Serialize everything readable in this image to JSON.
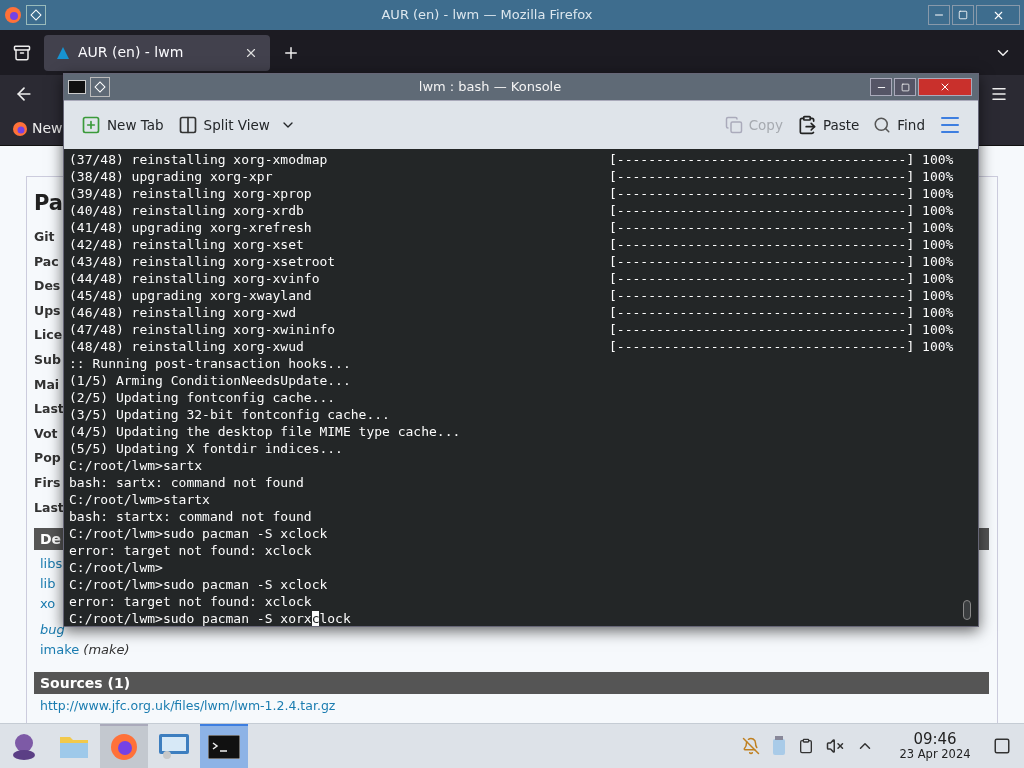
{
  "firefox": {
    "title": "AUR (en) - lwm — Mozilla Firefox",
    "tabs": [
      {
        "label": "AUR (en) - lwm",
        "selected": true
      }
    ],
    "bookmarks": [
      "New"
    ],
    "page": {
      "heading": "Pa",
      "fields": [
        "Git",
        "Pac",
        "Des",
        "Ups",
        "Lice",
        "Sub",
        "Mai",
        "Last",
        "Vot",
        "Pop",
        "Firs",
        "Last"
      ],
      "dependencies_header": "De",
      "dependencies": [
        {
          "name": "libs",
          "italic": false
        },
        {
          "name": "lib",
          "italic": false
        },
        {
          "name": "xo",
          "italic": false
        },
        {
          "name": "bug",
          "italic": true
        },
        {
          "name": "imake",
          "note": "(make)",
          "italic": false
        }
      ],
      "sources_header": "Sources (1)",
      "sources": [
        "http://www.jfc.org.uk/files/lwm/lwm-1.2.4.tar.gz"
      ]
    }
  },
  "konsole": {
    "title": "lwm : bash — Konsole",
    "toolbar": [
      {
        "label": "New Tab",
        "kind": "newtab",
        "disabled": false
      },
      {
        "label": "Split View",
        "kind": "split",
        "disabled": false
      },
      {
        "label": "Copy",
        "kind": "copy",
        "disabled": true
      },
      {
        "label": "Paste",
        "kind": "paste",
        "disabled": false
      },
      {
        "label": "Find",
        "kind": "find",
        "disabled": false
      }
    ],
    "lines": [
      {
        "text": "(37/48) reinstalling xorg-xmodmap",
        "progress": "[-------------------------------------] 100%"
      },
      {
        "text": "(38/48) upgrading xorg-xpr",
        "progress": "[-------------------------------------] 100%"
      },
      {
        "text": "(39/48) reinstalling xorg-xprop",
        "progress": "[-------------------------------------] 100%"
      },
      {
        "text": "(40/48) reinstalling xorg-xrdb",
        "progress": "[-------------------------------------] 100%"
      },
      {
        "text": "(41/48) upgrading xorg-xrefresh",
        "progress": "[-------------------------------------] 100%"
      },
      {
        "text": "(42/48) reinstalling xorg-xset",
        "progress": "[-------------------------------------] 100%"
      },
      {
        "text": "(43/48) reinstalling xorg-xsetroot",
        "progress": "[-------------------------------------] 100%"
      },
      {
        "text": "(44/48) reinstalling xorg-xvinfo",
        "progress": "[-------------------------------------] 100%"
      },
      {
        "text": "(45/48) upgrading xorg-xwayland",
        "progress": "[-------------------------------------] 100%"
      },
      {
        "text": "(46/48) reinstalling xorg-xwd",
        "progress": "[-------------------------------------] 100%"
      },
      {
        "text": "(47/48) reinstalling xorg-xwininfo",
        "progress": "[-------------------------------------] 100%"
      },
      {
        "text": "(48/48) reinstalling xorg-xwud",
        "progress": "[-------------------------------------] 100%"
      },
      {
        "text": ":: Running post-transaction hooks..."
      },
      {
        "text": "(1/5) Arming ConditionNeedsUpdate..."
      },
      {
        "text": "(2/5) Updating fontconfig cache..."
      },
      {
        "text": "(3/5) Updating 32-bit fontconfig cache..."
      },
      {
        "text": "(4/5) Updating the desktop file MIME type cache..."
      },
      {
        "text": "(5/5) Updating X fontdir indices..."
      },
      {
        "text": "C:/root/lwm>sartx"
      },
      {
        "text": "bash: sartx: command not found"
      },
      {
        "text": "C:/root/lwm>startx"
      },
      {
        "text": "bash: startx: command not found"
      },
      {
        "text": "C:/root/lwm>sudo pacman -S xclock"
      },
      {
        "text": "error: target not found: xclock"
      },
      {
        "text": "C:/root/lwm>"
      },
      {
        "text": "C:/root/lwm>sudo pacman -S xclock"
      },
      {
        "text": "error: target not found: xclock"
      },
      {
        "text": "C:/root/lwm>sudo pacman -S xorx",
        "cursor": "c",
        "after": "lock"
      }
    ]
  },
  "taskbar": {
    "apps": [
      {
        "kind": "launcher",
        "running": false,
        "selected": false
      },
      {
        "kind": "files",
        "running": false,
        "selected": false
      },
      {
        "kind": "firefox",
        "running": true,
        "selected": false
      },
      {
        "kind": "settings",
        "running": false,
        "selected": false
      },
      {
        "kind": "terminal",
        "running": true,
        "selected": true
      }
    ],
    "clock": {
      "time": "09:46",
      "date": "23 Apr 2024"
    }
  }
}
